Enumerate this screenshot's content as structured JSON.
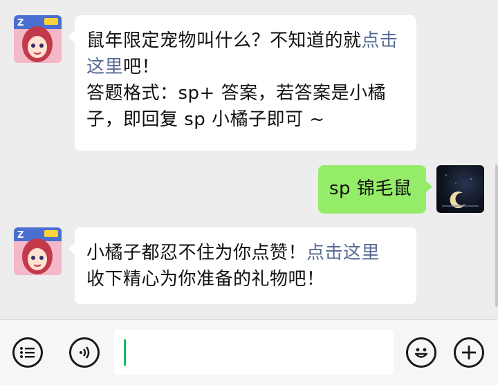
{
  "messages": [
    {
      "side": "left",
      "segments": [
        {
          "text": "鼠年限定宠物叫什么？不知道的就",
          "link": false
        },
        {
          "text": "点击这里",
          "link": true
        },
        {
          "text": "吧！",
          "link": false
        },
        {
          "text": "答题格式：sp+ 答案，若答案是小橘子，即回复 sp 小橘子即可 ~",
          "link": false
        }
      ]
    },
    {
      "side": "right",
      "text": "sp 锦毛鼠"
    },
    {
      "side": "left",
      "segments": [
        {
          "text": "小橘子都忍不住为你点赞！",
          "link": false
        },
        {
          "text": "点击这里",
          "link": true
        },
        {
          "text": "收下精心为你准备的礼物吧！",
          "link": false
        }
      ]
    }
  ],
  "colors": {
    "background": "#ededed",
    "bubble_left": "#ffffff",
    "bubble_right": "#95ec69",
    "link": "#576b95",
    "cursor": "#07c160"
  },
  "icons": {
    "menu": "list-menu-icon",
    "voice": "voice-icon",
    "emoji": "emoji-icon",
    "add": "plus-icon"
  },
  "input": {
    "value": ""
  }
}
